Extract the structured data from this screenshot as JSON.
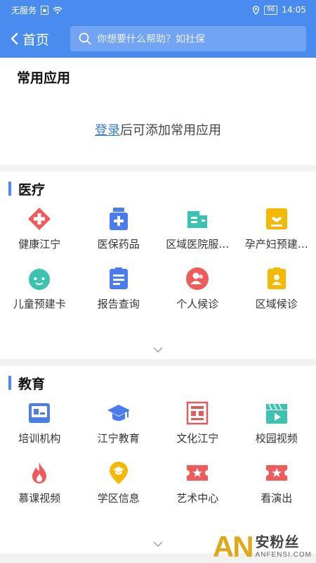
{
  "status_bar": {
    "carrier": "无服务",
    "battery": "96",
    "time": "14:05"
  },
  "nav": {
    "back_label": "首页",
    "search_placeholder": "你想要什么帮助？如社保"
  },
  "frequent": {
    "title": "常用应用",
    "login_link": "登录",
    "tip_rest": "后可添加常用应用"
  },
  "sections": [
    {
      "title": "医疗",
      "items": [
        {
          "label": "健康江宁",
          "icon": "health-cross-icon",
          "color": "#ef5b5b"
        },
        {
          "label": "医保药品",
          "icon": "medicine-bottle-icon",
          "color": "#4a7bef"
        },
        {
          "label": "区域医院服…",
          "icon": "hospital-card-icon",
          "color": "#3cc2b0"
        },
        {
          "label": "孕产妇预建…",
          "icon": "maternal-card-icon",
          "color": "#f5b800"
        },
        {
          "label": "儿童预建卡",
          "icon": "child-face-icon",
          "color": "#3cc2b0"
        },
        {
          "label": "报告查询",
          "icon": "report-list-icon",
          "color": "#4a7bef"
        },
        {
          "label": "个人候诊",
          "icon": "personal-queue-icon",
          "color": "#ef5b5b"
        },
        {
          "label": "区域候诊",
          "icon": "regional-queue-icon",
          "color": "#f5b800"
        }
      ]
    },
    {
      "title": "教育",
      "items": [
        {
          "label": "培训机构",
          "icon": "training-board-icon",
          "color": "#4a7bef"
        },
        {
          "label": "江宁教育",
          "icon": "graduation-cap-icon",
          "color": "#4a7bef"
        },
        {
          "label": "文化江宁",
          "icon": "culture-seal-icon",
          "color": "#e05a5a"
        },
        {
          "label": "校园视频",
          "icon": "video-clapper-icon",
          "color": "#3cc2b0"
        },
        {
          "label": "慕课视频",
          "icon": "flame-icon",
          "color": "#ef5b5b"
        },
        {
          "label": "学区信息",
          "icon": "location-pin-icon",
          "color": "#f5b800"
        },
        {
          "label": "艺术中心",
          "icon": "art-ticket-icon",
          "color": "#ef5b5b"
        },
        {
          "label": "看演出",
          "icon": "show-ticket-icon",
          "color": "#ef5b5b"
        }
      ]
    }
  ],
  "watermark": {
    "big": "AN",
    "cn": "安粉丝",
    "en": "ANFENSI.COM"
  }
}
